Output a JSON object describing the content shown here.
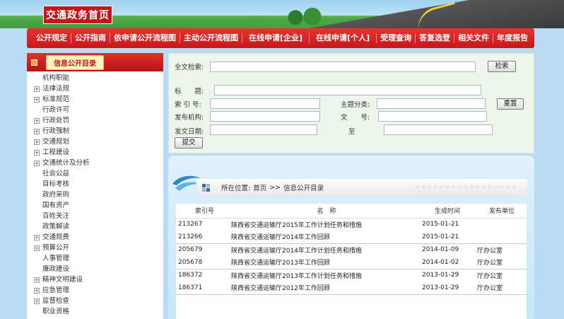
{
  "header": {
    "site_title": "交通政务首页"
  },
  "nav": [
    "公开规定",
    "公开指南",
    "依申请公开流程图",
    "主动公开流程图",
    "在线申请[企业]",
    "在线申请[个人]",
    "受理查询",
    "答复选登",
    "相关文件",
    "年度报告"
  ],
  "sidebar": {
    "title": "信息公开目录",
    "items": [
      {
        "label": "机构职能",
        "expandable": false,
        "indent": 0
      },
      {
        "label": "法律法规",
        "expandable": true,
        "indent": 0
      },
      {
        "label": "标准规范",
        "expandable": true,
        "indent": 0
      },
      {
        "label": "行政许可",
        "expandable": false,
        "indent": 0
      },
      {
        "label": "行政处罚",
        "expandable": true,
        "indent": 0
      },
      {
        "label": "行政强制",
        "expandable": true,
        "indent": 0
      },
      {
        "label": "交通规划",
        "expandable": true,
        "indent": 0
      },
      {
        "label": "工程建设",
        "expandable": true,
        "indent": 0
      },
      {
        "label": "交通统计及分析",
        "expandable": true,
        "indent": 0
      },
      {
        "label": "社会公益",
        "expandable": false,
        "indent": 0
      },
      {
        "label": "目标考核",
        "expandable": false,
        "indent": 0
      },
      {
        "label": "政府采购",
        "expandable": false,
        "indent": 0
      },
      {
        "label": "国有资产",
        "expandable": false,
        "indent": 0
      },
      {
        "label": "百姓关注",
        "expandable": false,
        "indent": 0
      },
      {
        "label": "政策解读",
        "expandable": false,
        "indent": 0
      },
      {
        "label": "交通规费",
        "expandable": true,
        "indent": 0
      },
      {
        "label": "预算公开",
        "expandable": true,
        "indent": 0
      },
      {
        "label": "人事管理",
        "expandable": false,
        "indent": 0
      },
      {
        "label": "廉政建设",
        "expandable": false,
        "indent": 0
      },
      {
        "label": "精神文明建设",
        "expandable": true,
        "indent": 0
      },
      {
        "label": "应急管理",
        "expandable": true,
        "indent": 0
      },
      {
        "label": "监督检查",
        "expandable": true,
        "indent": 0
      },
      {
        "label": "职业资格",
        "expandable": false,
        "indent": 0
      }
    ]
  },
  "search": {
    "fulltext_label": "全文检索:",
    "fulltext_button": "检索",
    "title_label": "标　　题:",
    "index_label": "索 引 号:",
    "topic_label": "主题分类:",
    "reset_button": "重置",
    "org_label": "发布机构:",
    "docno_label": "文　　号:",
    "date_label": "发文日期:",
    "to_label": "至",
    "submit_button": "提交"
  },
  "breadcrumb": {
    "prefix": "所在位置:",
    "home": "首页",
    "sep": ">>",
    "current": "信息公开目录",
    "decor": "≈≈≈≈≈≈≈≈≈≈≈≈≈≈≈≈≈"
  },
  "table": {
    "headers": [
      "索引号",
      "名　称",
      "生成时间",
      "发布单位"
    ],
    "rows": [
      {
        "index": "213267",
        "name": "陕西省交通运输厅2015年工作计划任务和措施",
        "date": "2015-01-21",
        "unit": ""
      },
      {
        "index": "213266",
        "name": "陕西省交通运输厅2014年工作回顾",
        "date": "2015-01-21",
        "unit": ""
      },
      {
        "index": "205679",
        "name": "陕西省交通运输厅2014年工作计划任务和措施",
        "date": "2014-01-09",
        "unit": "厅办公室"
      },
      {
        "index": "205678",
        "name": "陕西省交通运输厅2013年工作回顾",
        "date": "2014-01-02",
        "unit": "厅办公室"
      },
      {
        "index": "186372",
        "name": "陕西省交通运输厅2013年工作计划任务和措施",
        "date": "2013-01-29",
        "unit": "厅办公室"
      },
      {
        "index": "186371",
        "name": "陕西省交通运输厅2012年工作回顾",
        "date": "2013-01-29",
        "unit": "厅办公室"
      }
    ]
  }
}
